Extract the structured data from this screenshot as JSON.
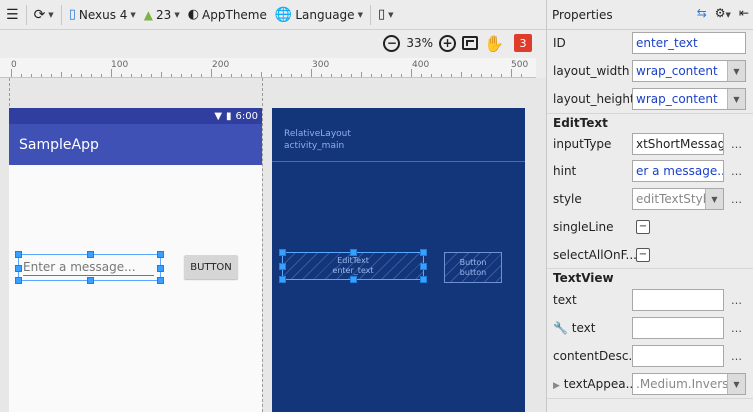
{
  "toolbar": {
    "device": "Nexus 4",
    "api": "23",
    "theme": "AppTheme",
    "language": "Language"
  },
  "zoom": {
    "percent": "33%",
    "error_count": "3"
  },
  "ruler": {
    "labels": [
      "0",
      "100",
      "200",
      "300",
      "400",
      "500"
    ]
  },
  "preview": {
    "status_time": "6:00",
    "app_title": "SampleApp",
    "edit_hint": "Enter a message...",
    "button_label": "BUTTON"
  },
  "blueprint": {
    "root_type": "RelativeLayout",
    "root_id": "activity_main",
    "edit_type": "EditText",
    "edit_id": "enter_text",
    "button_type": "Button",
    "button_id": "button"
  },
  "properties": {
    "title": "Properties",
    "id_label": "ID",
    "id_value": "enter_text",
    "layout_width_label": "layout_width",
    "layout_width_value": "wrap_content",
    "layout_height_label": "layout_height",
    "layout_height_value": "wrap_content",
    "edittext_section": "EditText",
    "input_type_label": "inputType",
    "input_type_value": "xtShortMessage",
    "hint_label": "hint",
    "hint_value": "er a message...",
    "style_label": "style",
    "style_value": "editTextStyle",
    "single_line_label": "singleLine",
    "select_all_label": "selectAllOnF...",
    "textview_section": "TextView",
    "text_label": "text",
    "text_tools_label": "text",
    "content_desc_label": "contentDesc...",
    "text_appearance_label": "textAppea...",
    "text_appearance_value": ".Medium.Inverse",
    "ellipsis": "…",
    "checkbox_glyph": "−"
  }
}
